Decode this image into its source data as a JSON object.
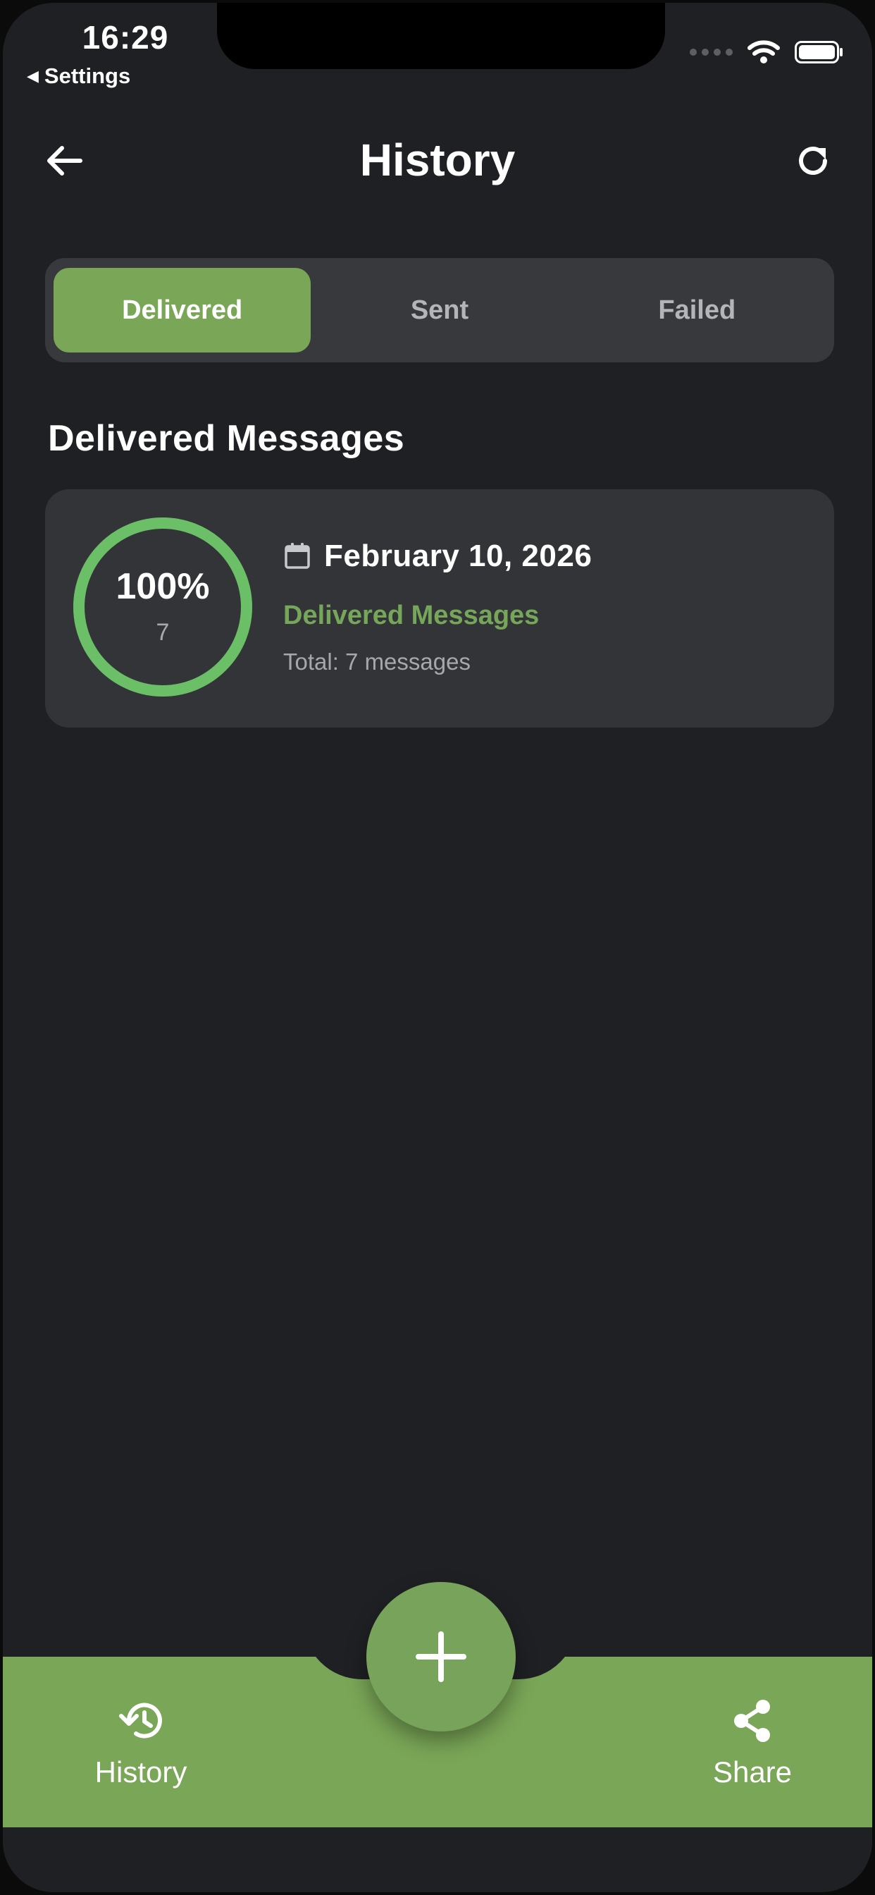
{
  "status_bar": {
    "time": "16:29",
    "back_app": "Settings"
  },
  "header": {
    "title": "History"
  },
  "tabs": [
    {
      "label": "Delivered",
      "active": true
    },
    {
      "label": "Sent",
      "active": false
    },
    {
      "label": "Failed",
      "active": false
    }
  ],
  "section": {
    "title": "Delivered Messages"
  },
  "card": {
    "percent_label": "100%",
    "percent_value": 1.0,
    "count": "7",
    "date": "February 10, 2026",
    "status": "Delivered Messages",
    "total": "Total: 7 messages"
  },
  "bottom_nav": {
    "history_label": "History",
    "share_label": "Share"
  },
  "colors": {
    "accent": "#7aa657",
    "background": "#1f2023",
    "card": "#333437",
    "segment_track": "#38393c",
    "ring": "#6bbf67"
  },
  "icons": {
    "back": "arrow-left-icon",
    "refresh": "refresh-icon",
    "calendar": "calendar-icon",
    "add": "plus-icon",
    "history": "history-icon",
    "share": "share-icon",
    "wifi": "wifi-icon",
    "battery": "battery-icon"
  }
}
